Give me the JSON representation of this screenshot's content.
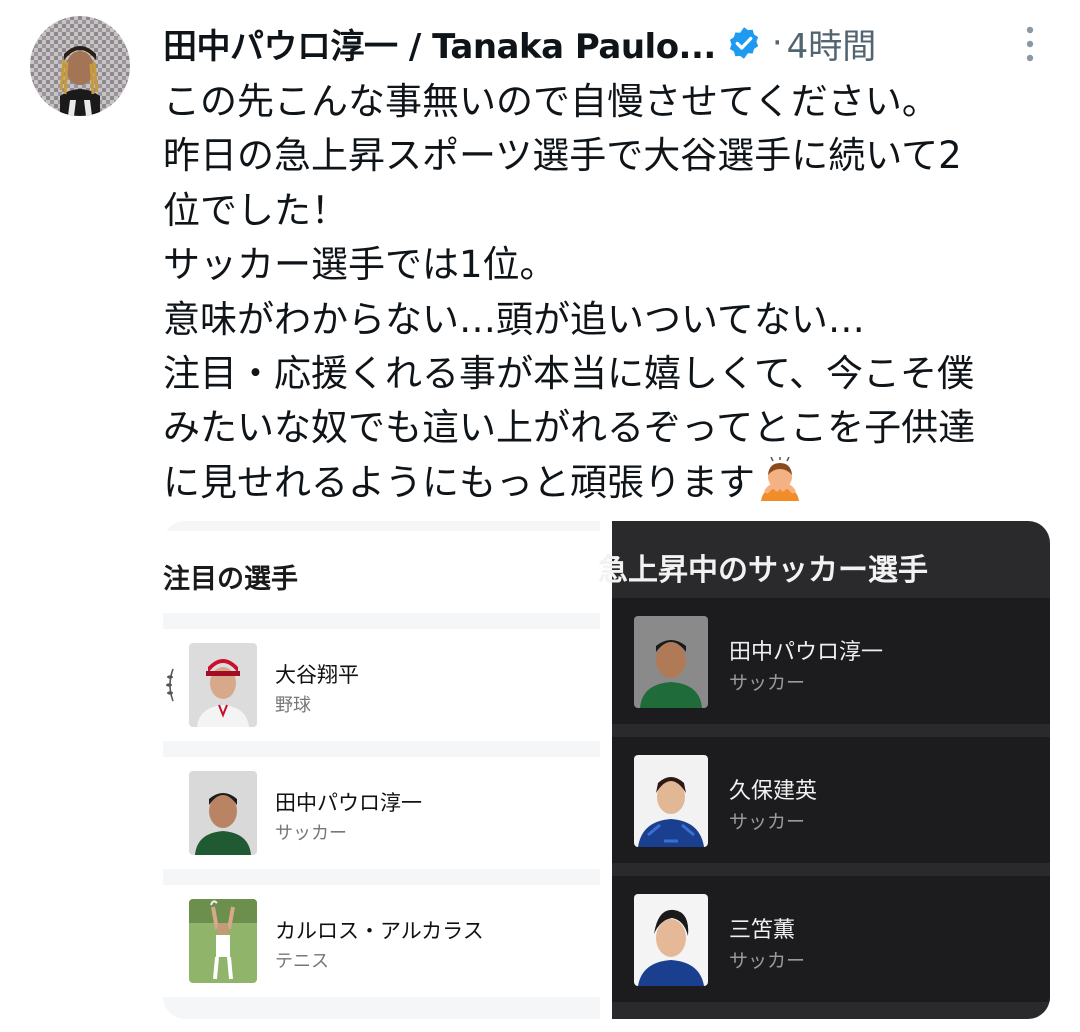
{
  "tweet": {
    "author_name": "田中パウロ淳一 / Tanaka Paulo...",
    "separator": "·",
    "time": "4時間",
    "avatar_icon": "user-avatar",
    "verified_icon": "verified-badge-icon",
    "more_icon": "more-options-icon",
    "text_lines": [
      "この先こんな事無いので自慢させてください。",
      "昨日の急上昇スポーツ選手で大谷選手に続いて2",
      "位でした！",
      "サッカー選手では1位。",
      "意味がわからない…頭が追いついてない…",
      "注目・応援くれる事が本当に嬉しくて、今こそ僕",
      "みたいな奴でも這い上がれるぞってとこを子供達",
      "に見せれるようにもっと頑張ります"
    ],
    "trailing_emoji": "person-bowing-emoji"
  },
  "media": {
    "left_panel": {
      "title": "注目の選手",
      "players": [
        {
          "name": "大谷翔平",
          "sport": "野球"
        },
        {
          "name": "田中パウロ淳一",
          "sport": "サッカー"
        },
        {
          "name": "カルロス・アルカラス",
          "sport": "テニス"
        }
      ]
    },
    "right_panel": {
      "title": "急上昇中のサッカー選手",
      "players": [
        {
          "name": "田中パウロ淳一",
          "sport": "サッカー"
        },
        {
          "name": "久保建英",
          "sport": "サッカー"
        },
        {
          "name": "三笘薫",
          "sport": "サッカー"
        }
      ]
    }
  },
  "colors": {
    "verified_blue": "#1d9bf0",
    "secondary_text": "#536471",
    "dark_panel_bg": "#2a2a2c",
    "dark_card_bg": "#1c1c1e"
  }
}
